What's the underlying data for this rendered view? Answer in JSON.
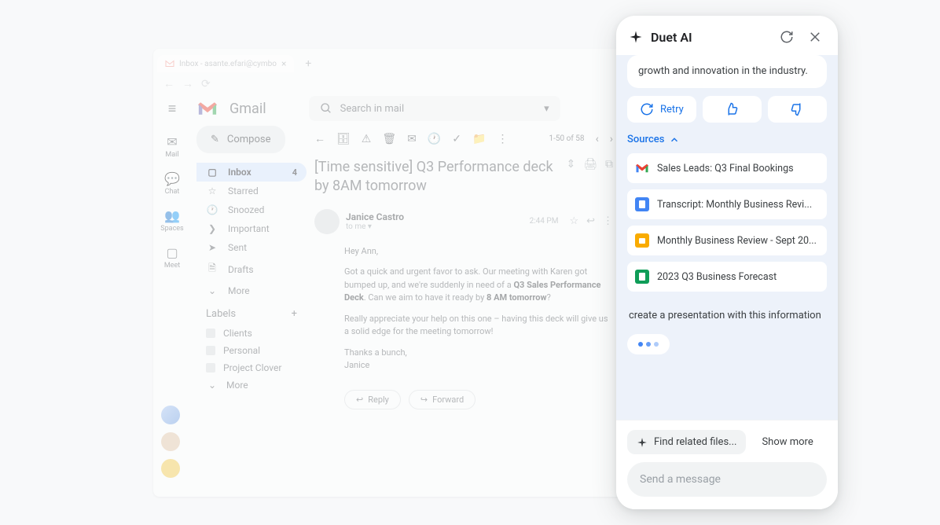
{
  "browser": {
    "tab_title": "Inbox - asante.efari@cymbo",
    "new_tab": "+"
  },
  "app_rail": {
    "items": [
      {
        "icon": "mail-icon",
        "label": "Mail"
      },
      {
        "icon": "chat-icon",
        "label": "Chat"
      },
      {
        "icon": "spaces-icon",
        "label": "Spaces"
      },
      {
        "icon": "meet-icon",
        "label": "Meet"
      }
    ]
  },
  "gmail": {
    "wordmark": "Gmail",
    "search_placeholder": "Search in mail",
    "compose": "Compose",
    "nav": [
      {
        "icon": "inbox-icon",
        "label": "Inbox",
        "count": "4",
        "active": true
      },
      {
        "icon": "star-icon",
        "label": "Starred"
      },
      {
        "icon": "snooze-icon",
        "label": "Snoozed"
      },
      {
        "icon": "important-icon",
        "label": "Important"
      },
      {
        "icon": "sent-icon",
        "label": "Sent"
      },
      {
        "icon": "drafts-icon",
        "label": "Drafts"
      },
      {
        "icon": "more-icon",
        "label": "More"
      }
    ],
    "labels_header": "Labels",
    "labels": [
      {
        "label": "Clients"
      },
      {
        "label": "Personal"
      },
      {
        "label": "Project Clover"
      },
      {
        "label": "More"
      }
    ],
    "toolbar": {
      "count": "1-50 of 58"
    },
    "email": {
      "subject": "[Time sensitive] Q3 Performance deck by 8AM tomorrow",
      "sender": "Janice Castro",
      "to": "to me ▾",
      "time": "2:44 PM",
      "greeting": "Hey Ann,",
      "p1a": "Got a quick and urgent favor to ask. Our meeting with Karen got bumped up, and we're suddenly in need of a ",
      "p1b": "Q3 Sales Performance Deck",
      "p1c": ". Can we aim to have it ready by ",
      "p1d": "8 AM tomorrow",
      "p1e": "?",
      "p2": "Really appreciate your help on this one – having this deck will give us a solid edge for the meeting tomorrow!",
      "sig1": "Thanks a bunch,",
      "sig2": "Janice",
      "reply": "Reply",
      "forward": "Forward"
    }
  },
  "duet": {
    "title": "Duet AI",
    "response_tail": "growth and innovation in the industry.",
    "retry": "Retry",
    "sources_label": "Sources",
    "sources": [
      {
        "type": "gmail",
        "title": "Sales Leads: Q3 Final Bookings"
      },
      {
        "type": "docs",
        "title": "Transcript: Monthly Business Revi..."
      },
      {
        "type": "slides",
        "title": "Monthly Business Review - Sept 20..."
      },
      {
        "type": "sheets",
        "title": "2023 Q3 Business Forecast"
      }
    ],
    "user_message": "create a presentation with this information",
    "suggestion_chip": "Find related files...",
    "show_more": "Show more",
    "compose_placeholder": "Send a message"
  }
}
